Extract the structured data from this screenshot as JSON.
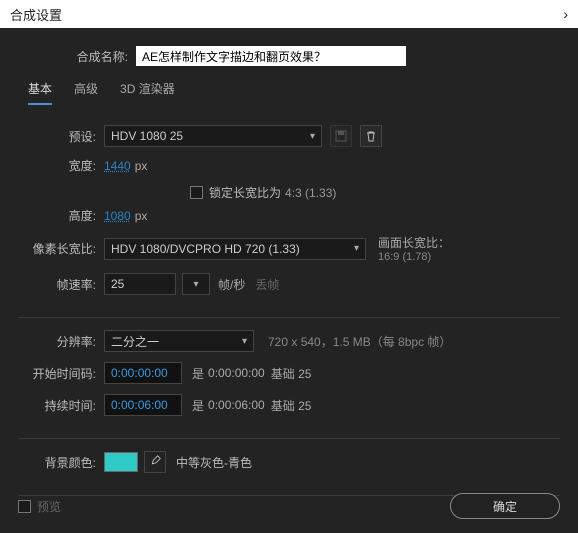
{
  "title": "合成设置",
  "comp_name_label": "合成名称:",
  "comp_name": "AE怎样制作文字描边和翻页效果？",
  "tabs": {
    "basic": "基本",
    "advanced": "高级",
    "renderer": "3D 渲染器"
  },
  "preset": {
    "label": "预设:",
    "value": "HDV 1080 25"
  },
  "width": {
    "label": "宽度:",
    "value": "1440",
    "unit": "px"
  },
  "height": {
    "label": "高度:",
    "value": "1080",
    "unit": "px"
  },
  "lock_aspect": {
    "label": "锁定长宽比为",
    "ratio": "4:3 (1.33)"
  },
  "par": {
    "label": "像素长宽比:",
    "value": "HDV 1080/DVCPRO HD 720 (1.33)"
  },
  "frame_aspect": {
    "label": "画面长宽比：",
    "value": "16:9 (1.78)"
  },
  "fps": {
    "label": "帧速率:",
    "value": "25",
    "unit": "帧/秒",
    "drop": "丢帧"
  },
  "resolution": {
    "label": "分辨率:",
    "value": "二分之一",
    "info": "720 x 540，1.5 MB（每 8bpc 帧）"
  },
  "start": {
    "label": "开始时间码:",
    "value": "0:00:00:00",
    "is": "是",
    "ref": "0:00:00:00",
    "base": "基础 25"
  },
  "duration": {
    "label": "持续时间:",
    "value": "0:00:06:00",
    "is": "是",
    "ref": "0:00:06:00",
    "base": "基础 25"
  },
  "bg": {
    "label": "背景颜色:",
    "hex": "#2fc9c6",
    "name": "中等灰色-青色"
  },
  "preview": "预览",
  "ok": "确定"
}
